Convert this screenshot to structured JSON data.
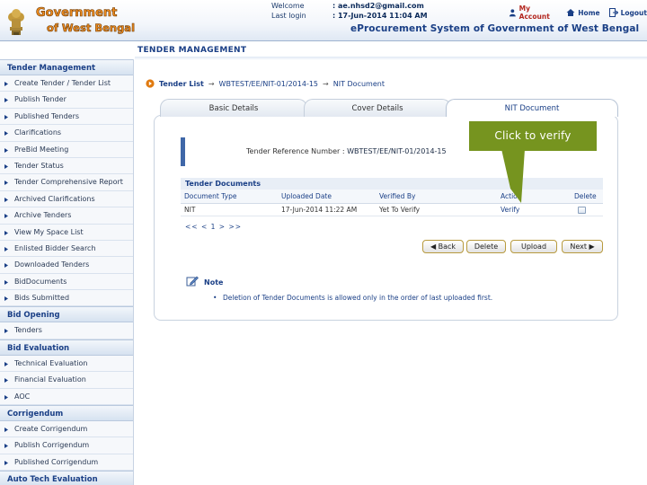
{
  "header": {
    "logo_line1": "Government",
    "logo_line2": "of West Bengal",
    "welcome_label": "Welcome",
    "welcome_value": ": ae.nhsd2@gmail.com",
    "last_login_label": "Last login",
    "last_login_value": ": 17-Jun-2014 11:04 AM",
    "links": [
      "My Account",
      "Home",
      "Logout"
    ],
    "system_title": "eProcurement System of Government of West Bengal"
  },
  "page_title": "TENDER MANAGEMENT",
  "sidebar": {
    "sections": [
      {
        "title": "Tender Management",
        "items": [
          "Create Tender / Tender List",
          "Publish Tender",
          "Published Tenders",
          "Clarifications",
          "PreBid Meeting",
          "Tender Status",
          "Tender Comprehensive Report",
          "Archived Clarifications",
          "Archive Tenders",
          "View My Space List",
          "Enlisted Bidder Search",
          "Downloaded Tenders",
          "BidDocuments",
          "Bids Submitted"
        ]
      },
      {
        "title": "Bid Opening",
        "items": [
          "Tenders"
        ]
      },
      {
        "title": "Bid Evaluation",
        "items": [
          "Technical Evaluation",
          "Financial Evaluation",
          "AOC"
        ]
      },
      {
        "title": "Corrigendum",
        "items": [
          "Create Corrigendum",
          "Publish Corrigendum",
          "Published Corrigendum"
        ]
      },
      {
        "title": "Auto Tech Evaluation",
        "items": []
      }
    ]
  },
  "breadcrumb": [
    "Tender List",
    "WBTEST/EE/NIT-01/2014-15",
    "NIT Document"
  ],
  "tabs": [
    {
      "label": "Basic Details",
      "active": false
    },
    {
      "label": "Cover Details",
      "active": false
    },
    {
      "label": "NIT Document",
      "active": true
    }
  ],
  "reference": {
    "label": "Tender Reference Number :",
    "value": "WBTEST/EE/NIT-01/2014-15"
  },
  "callout": "Click to verify",
  "documents": {
    "title": "Tender Documents",
    "columns": [
      "Document Type",
      "Uploaded Date",
      "Verified By",
      "Action",
      "Delete"
    ],
    "rows": [
      {
        "type": "NIT",
        "date": "17-Jun-2014 11:22 AM",
        "verified_by": "Yet To Verify",
        "action": "Verify"
      }
    ],
    "pager": "<< < 1 > >>"
  },
  "buttons": {
    "back": "Back",
    "delete": "Delete",
    "upload": "Upload",
    "next": "Next"
  },
  "note": {
    "title": "Note",
    "text": "Deletion of Tender Documents is allowed only in the order of last uploaded first."
  },
  "colors": {
    "brand_blue": "#1a3f86",
    "callout_green": "#76941f",
    "logo_orange": "#f08c1e"
  }
}
